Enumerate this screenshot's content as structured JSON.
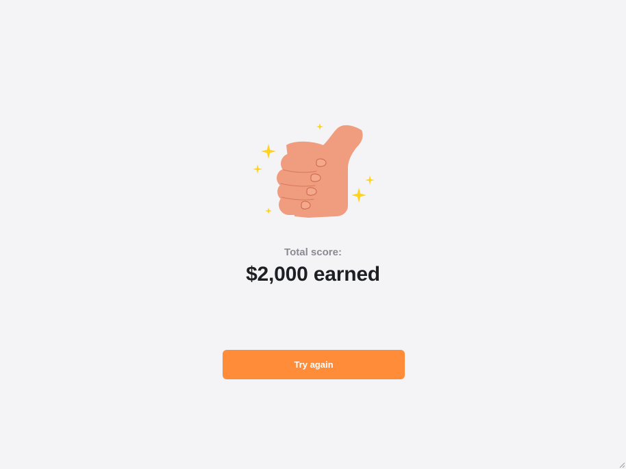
{
  "result": {
    "score_label": "Total score:",
    "score_value": "$2,000 earned"
  },
  "actions": {
    "try_again_label": "Try again"
  },
  "icons": {
    "illustration": "thumbs-up-icon",
    "decoration": "sparkle-icon",
    "corner": "resize-grip-icon"
  },
  "colors": {
    "background": "#f4f4f6",
    "accent": "#ff8c38",
    "skin": "#f09c7e",
    "sparkle": "#ffd21f",
    "heading": "#1e1f24",
    "muted": "#8a8a92"
  }
}
